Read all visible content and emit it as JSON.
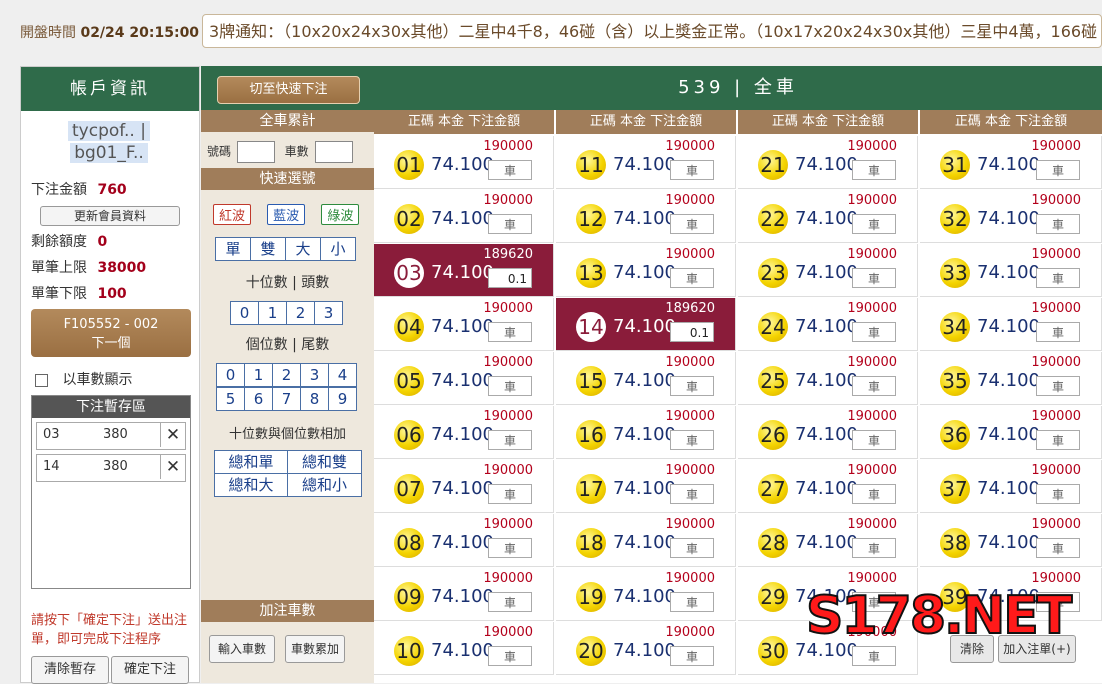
{
  "header": {
    "open_time_label": "開盤時間",
    "open_time": "02/24 20:15:00",
    "notice": "3牌通知：（10x20x24x30x其他）二星中4千8，46碰（含）以上獎金正常。（10x17x20x24x30x其他）三星中4萬，166碰（含）"
  },
  "account": {
    "title": "帳戶資訊",
    "user_line1": "tycpof..  |",
    "user_line2": "bg01_F..",
    "bet_amount_label": "下注金額",
    "bet_amount": "760",
    "refresh_button": "更新會員資料",
    "remaining_label": "剩餘額度",
    "remaining": "0",
    "max_label": "單筆上限",
    "max": "38000",
    "min_label": "單筆下限",
    "min": "100",
    "next_line1": "F105552 - 002",
    "next_line2": "下一個",
    "show_by_count": "以車數顯示",
    "stash_title": "下注暫存區",
    "stash": [
      {
        "num": "03",
        "amount": "380"
      },
      {
        "num": "14",
        "amount": "380"
      }
    ],
    "hint": "請按下「確定下注」送出注單，即可完成下注程序",
    "clear_button": "清除暫存",
    "confirm_button": "確定下注"
  },
  "quick": {
    "switch_button": "切至快速下注",
    "full_count_title": "全車累計",
    "num_label": "號碼",
    "count_label": "車數",
    "quick_select_title": "快速選號",
    "waves": [
      "紅波",
      "藍波",
      "綠波"
    ],
    "parity": [
      "單",
      "雙",
      "大",
      "小"
    ],
    "tens_title": "十位數 | 頭數",
    "tens": [
      "0",
      "1",
      "2",
      "3"
    ],
    "units_title": "個位數 | 尾數",
    "units_row1": [
      "0",
      "1",
      "2",
      "3",
      "4"
    ],
    "units_row2": [
      "5",
      "6",
      "7",
      "8",
      "9"
    ],
    "sum_title": "十位數與個位數相加",
    "sums": [
      "總和單",
      "總和雙",
      "總和大",
      "總和小"
    ],
    "add_count_title": "加注車數",
    "input_count_button": "輸入車數",
    "accumulate_button": "車數累加"
  },
  "main": {
    "title": "539 | 全車",
    "col_header": "正碼  本金  下注金額",
    "cells": [
      {
        "num": "01",
        "limit": "190000",
        "amt": "車",
        "sel": false
      },
      {
        "num": "02",
        "limit": "190000",
        "amt": "車",
        "sel": false
      },
      {
        "num": "03",
        "limit": "189620",
        "amt": "0.1",
        "sel": true
      },
      {
        "num": "04",
        "limit": "190000",
        "amt": "車",
        "sel": false
      },
      {
        "num": "05",
        "limit": "190000",
        "amt": "車",
        "sel": false
      },
      {
        "num": "06",
        "limit": "190000",
        "amt": "車",
        "sel": false
      },
      {
        "num": "07",
        "limit": "190000",
        "amt": "車",
        "sel": false
      },
      {
        "num": "08",
        "limit": "190000",
        "amt": "車",
        "sel": false
      },
      {
        "num": "09",
        "limit": "190000",
        "amt": "車",
        "sel": false
      },
      {
        "num": "10",
        "limit": "190000",
        "amt": "車",
        "sel": false
      },
      {
        "num": "11",
        "limit": "190000",
        "amt": "車",
        "sel": false
      },
      {
        "num": "12",
        "limit": "190000",
        "amt": "車",
        "sel": false
      },
      {
        "num": "13",
        "limit": "190000",
        "amt": "車",
        "sel": false
      },
      {
        "num": "14",
        "limit": "189620",
        "amt": "0.1",
        "sel": true
      },
      {
        "num": "15",
        "limit": "190000",
        "amt": "車",
        "sel": false
      },
      {
        "num": "16",
        "limit": "190000",
        "amt": "車",
        "sel": false
      },
      {
        "num": "17",
        "limit": "190000",
        "amt": "車",
        "sel": false
      },
      {
        "num": "18",
        "limit": "190000",
        "amt": "車",
        "sel": false
      },
      {
        "num": "19",
        "limit": "190000",
        "amt": "車",
        "sel": false
      },
      {
        "num": "20",
        "limit": "190000",
        "amt": "車",
        "sel": false
      },
      {
        "num": "21",
        "limit": "190000",
        "amt": "車",
        "sel": false
      },
      {
        "num": "22",
        "limit": "190000",
        "amt": "車",
        "sel": false
      },
      {
        "num": "23",
        "limit": "190000",
        "amt": "車",
        "sel": false
      },
      {
        "num": "24",
        "limit": "190000",
        "amt": "車",
        "sel": false
      },
      {
        "num": "25",
        "limit": "190000",
        "amt": "車",
        "sel": false
      },
      {
        "num": "26",
        "limit": "190000",
        "amt": "車",
        "sel": false
      },
      {
        "num": "27",
        "limit": "190000",
        "amt": "車",
        "sel": false
      },
      {
        "num": "28",
        "limit": "190000",
        "amt": "車",
        "sel": false
      },
      {
        "num": "29",
        "limit": "190000",
        "amt": "車",
        "sel": false
      },
      {
        "num": "30",
        "limit": "190000",
        "amt": "車",
        "sel": false
      },
      {
        "num": "31",
        "limit": "190000",
        "amt": "車",
        "sel": false
      },
      {
        "num": "32",
        "limit": "190000",
        "amt": "車",
        "sel": false
      },
      {
        "num": "33",
        "limit": "190000",
        "amt": "車",
        "sel": false
      },
      {
        "num": "34",
        "limit": "190000",
        "amt": "車",
        "sel": false
      },
      {
        "num": "35",
        "limit": "190000",
        "amt": "車",
        "sel": false
      },
      {
        "num": "36",
        "limit": "190000",
        "amt": "車",
        "sel": false
      },
      {
        "num": "37",
        "limit": "190000",
        "amt": "車",
        "sel": false
      },
      {
        "num": "38",
        "limit": "190000",
        "amt": "車",
        "sel": false
      },
      {
        "num": "39",
        "limit": "190000",
        "amt": "車",
        "sel": false
      }
    ],
    "odds": "74.100",
    "clear_button": "清除",
    "add_button": "加入注單(+)"
  },
  "watermark": "S178.NET"
}
